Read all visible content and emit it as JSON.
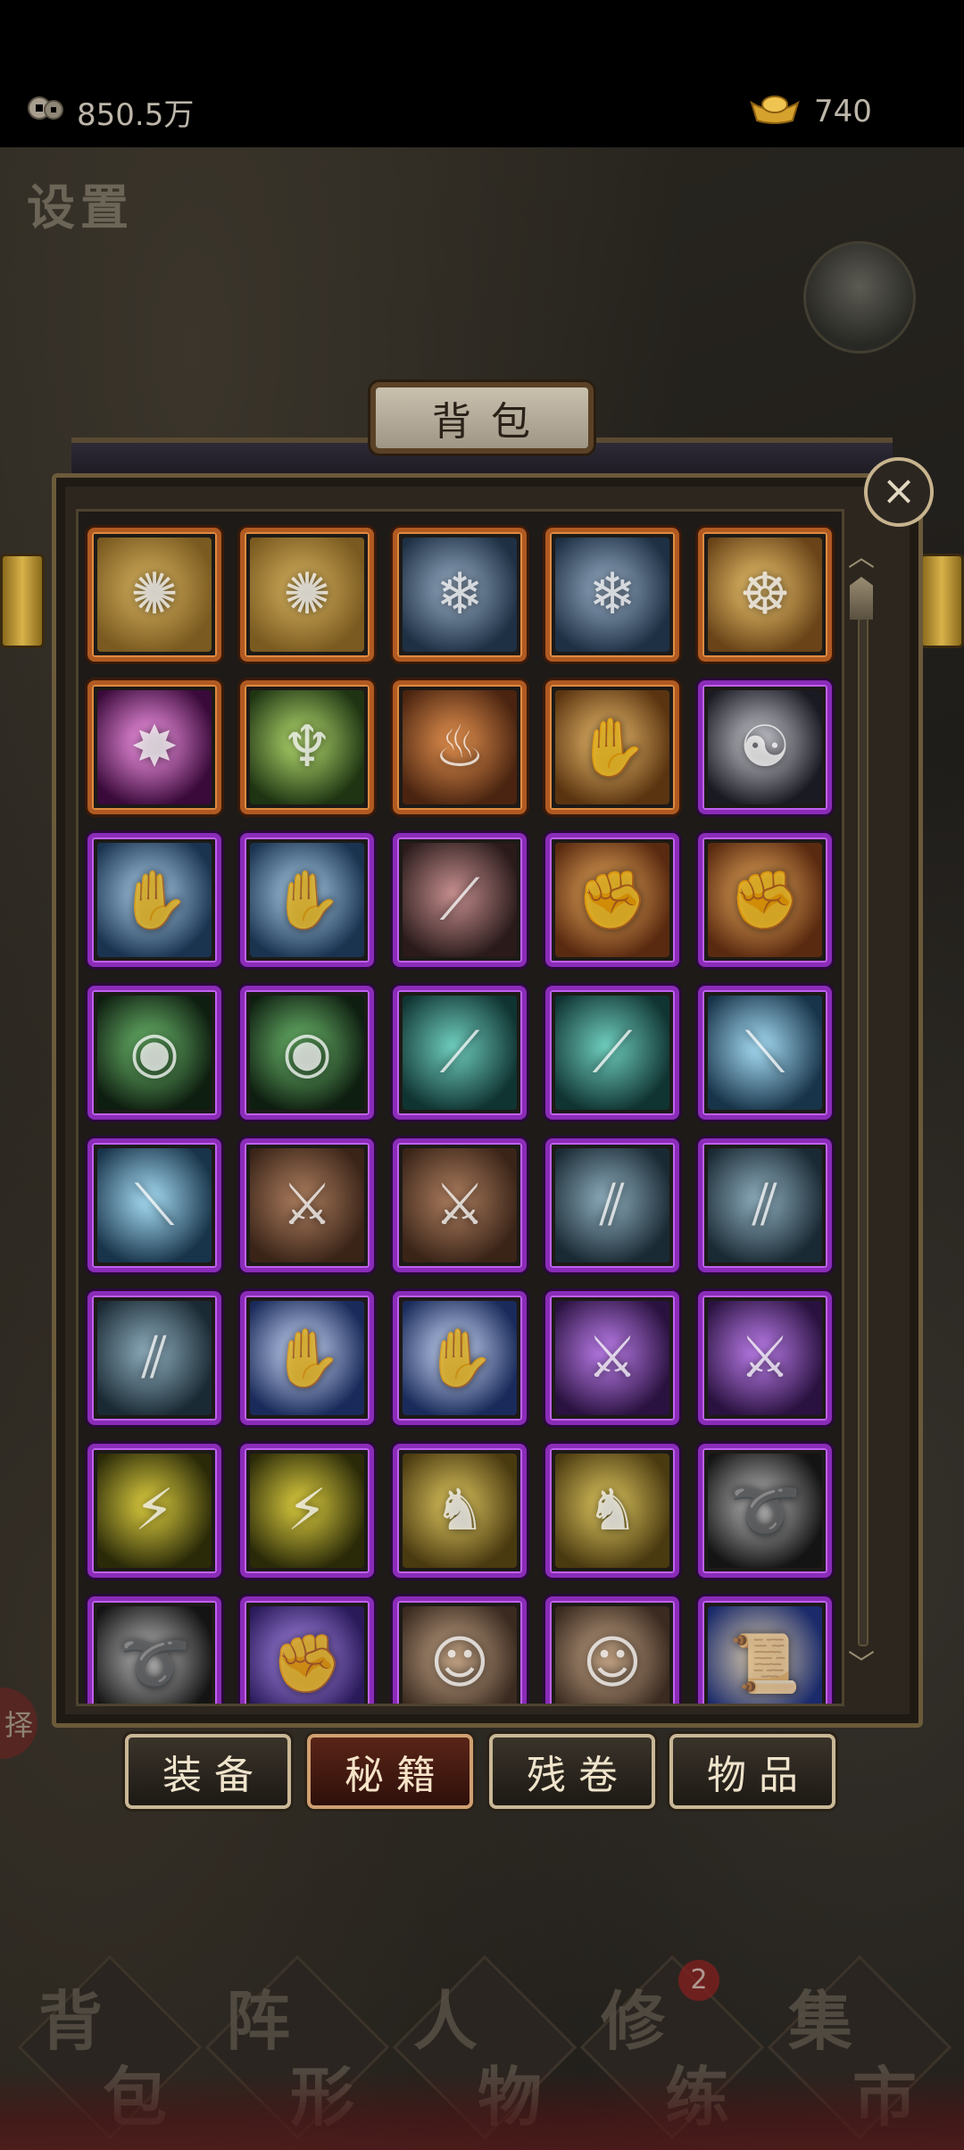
{
  "status_bar": {
    "coins": {
      "icon": "coin-icon",
      "value": "850.5万"
    },
    "ingots": {
      "icon": "gold-ingot-icon",
      "value": "740"
    }
  },
  "settings_label": "设置",
  "side_label": "择",
  "panel": {
    "title": "背包",
    "close_icon": "close-icon"
  },
  "items": [
    {
      "rarity": "orange",
      "theme": "golden-lotus-emblem",
      "colors": [
        "#7a5a20",
        "#d8b460"
      ],
      "glyph": "✺"
    },
    {
      "rarity": "orange",
      "theme": "golden-lotus-emblem",
      "colors": [
        "#7a5a20",
        "#d8b460"
      ],
      "glyph": "✺"
    },
    {
      "rarity": "orange",
      "theme": "blue-rope-sword",
      "colors": [
        "#1e3044",
        "#9ab0c8"
      ],
      "glyph": "❄"
    },
    {
      "rarity": "orange",
      "theme": "blue-rope-sword",
      "colors": [
        "#1e3044",
        "#9ab0c8"
      ],
      "glyph": "❄"
    },
    {
      "rarity": "orange",
      "theme": "meditating-buddha",
      "colors": [
        "#6a4418",
        "#f0c870"
      ],
      "glyph": "☸"
    },
    {
      "rarity": "orange",
      "theme": "pink-burst",
      "colors": [
        "#3a0a3a",
        "#ff9cf0"
      ],
      "glyph": "✸"
    },
    {
      "rarity": "orange",
      "theme": "green-dancer",
      "colors": [
        "#1e3412",
        "#b8e070"
      ],
      "glyph": "♆"
    },
    {
      "rarity": "orange",
      "theme": "fire-monk",
      "colors": [
        "#4a2410",
        "#e89450"
      ],
      "glyph": "♨"
    },
    {
      "rarity": "orange",
      "theme": "golden-palms",
      "colors": [
        "#5a3410",
        "#f0c070"
      ],
      "glyph": "✋"
    },
    {
      "rarity": "purple",
      "theme": "yin-yang-blade",
      "colors": [
        "#1a1a22",
        "#d0d0d8"
      ],
      "glyph": "☯"
    },
    {
      "rarity": "purple",
      "theme": "praying-hands",
      "colors": [
        "#1a3450",
        "#b0d4f0"
      ],
      "glyph": "✋"
    },
    {
      "rarity": "purple",
      "theme": "praying-hands",
      "colors": [
        "#1a3450",
        "#b0d4f0"
      ],
      "glyph": "✋"
    },
    {
      "rarity": "purple",
      "theme": "claw-slash",
      "colors": [
        "#2a1a1a",
        "#c89090"
      ],
      "glyph": "⟋"
    },
    {
      "rarity": "purple",
      "theme": "flaming-fist",
      "colors": [
        "#5a2a10",
        "#f0b060"
      ],
      "glyph": "✊"
    },
    {
      "rarity": "purple",
      "theme": "flaming-fist",
      "colors": [
        "#5a2a10",
        "#f0b060"
      ],
      "glyph": "✊"
    },
    {
      "rarity": "purple",
      "theme": "green-orb-ring",
      "colors": [
        "#0e1e10",
        "#70c070"
      ],
      "glyph": "◉"
    },
    {
      "rarity": "purple",
      "theme": "green-orb-ring",
      "colors": [
        "#0e1e10",
        "#70c070"
      ],
      "glyph": "◉"
    },
    {
      "rarity": "purple",
      "theme": "teal-spear",
      "colors": [
        "#103432",
        "#70d0c0"
      ],
      "glyph": "⟋"
    },
    {
      "rarity": "purple",
      "theme": "teal-spear",
      "colors": [
        "#103432",
        "#70d0c0"
      ],
      "glyph": "⟋"
    },
    {
      "rarity": "purple",
      "theme": "blue-staff",
      "colors": [
        "#18344a",
        "#a8e0f8"
      ],
      "glyph": "⟍"
    },
    {
      "rarity": "purple",
      "theme": "blue-staff",
      "colors": [
        "#18344a",
        "#a8e0f8"
      ],
      "glyph": "⟍"
    },
    {
      "rarity": "purple",
      "theme": "tiger-blade",
      "colors": [
        "#3a2418",
        "#b08060"
      ],
      "glyph": "⚔"
    },
    {
      "rarity": "purple",
      "theme": "tiger-blade",
      "colors": [
        "#3a2418",
        "#b08060"
      ],
      "glyph": "⚔"
    },
    {
      "rarity": "purple",
      "theme": "dual-sticks",
      "colors": [
        "#1a2a34",
        "#90b0c0"
      ],
      "glyph": "⫽"
    },
    {
      "rarity": "purple",
      "theme": "dual-sticks",
      "colors": [
        "#1a2a34",
        "#90b0c0"
      ],
      "glyph": "⫽"
    },
    {
      "rarity": "purple",
      "theme": "dual-sticks",
      "colors": [
        "#1a2a34",
        "#90b0c0"
      ],
      "glyph": "⫽"
    },
    {
      "rarity": "purple",
      "theme": "frost-palm",
      "colors": [
        "#1a2a5a",
        "#d0e0ff"
      ],
      "glyph": "✋"
    },
    {
      "rarity": "purple",
      "theme": "frost-palm",
      "colors": [
        "#1a2a5a",
        "#d0e0ff"
      ],
      "glyph": "✋"
    },
    {
      "rarity": "purple",
      "theme": "violet-blade",
      "colors": [
        "#2a1240",
        "#c080f0"
      ],
      "glyph": "⚔"
    },
    {
      "rarity": "purple",
      "theme": "violet-blade",
      "colors": [
        "#2a1240",
        "#c080f0"
      ],
      "glyph": "⚔"
    },
    {
      "rarity": "purple",
      "theme": "lightning-arrows",
      "colors": [
        "#2a2a08",
        "#e0d040"
      ],
      "glyph": "⚡"
    },
    {
      "rarity": "purple",
      "theme": "lightning-arrows",
      "colors": [
        "#2a2a08",
        "#e0d040"
      ],
      "glyph": "⚡"
    },
    {
      "rarity": "purple",
      "theme": "kicking-warrior",
      "colors": [
        "#4a3a10",
        "#e0c860"
      ],
      "glyph": "♞"
    },
    {
      "rarity": "purple",
      "theme": "kicking-warrior",
      "colors": [
        "#4a3a10",
        "#e0c860"
      ],
      "glyph": "♞"
    },
    {
      "rarity": "purple",
      "theme": "silver-whirl",
      "colors": [
        "#141414",
        "#c0c0c0"
      ],
      "glyph": "➰"
    },
    {
      "rarity": "purple",
      "theme": "silver-whirl",
      "colors": [
        "#141414",
        "#c0c0c0"
      ],
      "glyph": "➰"
    },
    {
      "rarity": "purple",
      "theme": "purple-fist",
      "colors": [
        "#2a1a5a",
        "#b090f0"
      ],
      "glyph": "✊"
    },
    {
      "rarity": "purple",
      "theme": "monk-portrait",
      "colors": [
        "#3a2a20",
        "#c8a888"
      ],
      "glyph": "☺"
    },
    {
      "rarity": "purple",
      "theme": "monk-portrait",
      "colors": [
        "#3a2a20",
        "#c8a888"
      ],
      "glyph": "☺"
    },
    {
      "rarity": "purple",
      "theme": "scroll-book",
      "colors": [
        "#1a2a6a",
        "#e0d0b0"
      ],
      "glyph": "📜"
    }
  ],
  "tabs": [
    {
      "label": "装备",
      "active": false
    },
    {
      "label": "秘籍",
      "active": true
    },
    {
      "label": "残卷",
      "active": false
    },
    {
      "label": "物品",
      "active": false
    }
  ],
  "bottom_nav": [
    {
      "top": "背",
      "bottom": "包"
    },
    {
      "top": "阵",
      "bottom": "形"
    },
    {
      "top": "人",
      "bottom": "物"
    },
    {
      "top": "修",
      "bottom": "练"
    },
    {
      "top": "集",
      "bottom": "市"
    }
  ],
  "bottom_nav_badge": "2"
}
